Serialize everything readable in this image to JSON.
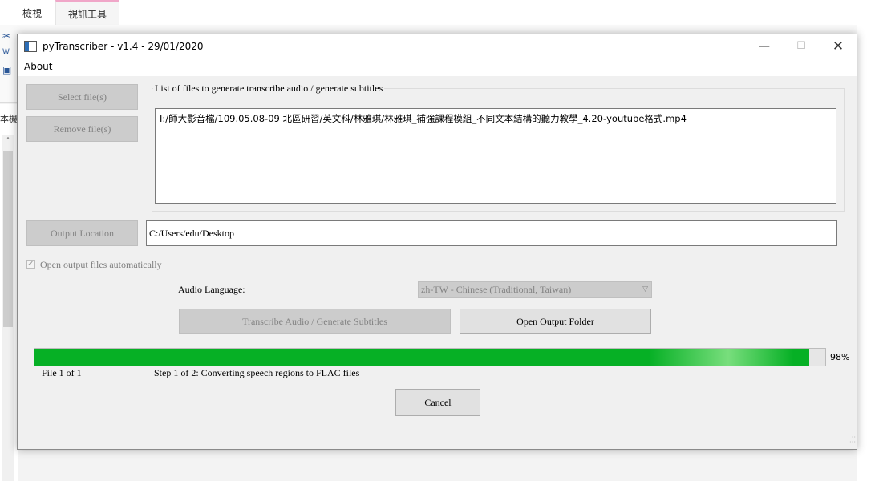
{
  "background": {
    "tabs": [
      "檢視",
      "視訊工具"
    ],
    "sidebar_label": "本機"
  },
  "window": {
    "title": "pyTranscriber - v1.4 - 29/01/2020",
    "menu": [
      "About"
    ]
  },
  "buttons": {
    "select_files": "Select file(s)",
    "remove_files": "Remove file(s)",
    "output_location": "Output Location",
    "transcribe": "Transcribe Audio / Generate Subtitles",
    "open_output_folder": "Open Output Folder",
    "cancel": "Cancel"
  },
  "file_list": {
    "label": "List of files to generate transcribe audio / generate subtitles",
    "items": [
      "I:/師大影音檔/109.05.08-09 北區研習/英文科/林雅琪/林雅琪_補強課程模組_不同文本結構的聽力教學_4.20-youtube格式.mp4"
    ]
  },
  "output": {
    "path": "C:/Users/edu/Desktop"
  },
  "options": {
    "open_automatically_label": "Open output files automatically",
    "open_automatically_checked": true
  },
  "language": {
    "label": "Audio Language:",
    "selected": "zh-TW - Chinese (Traditional, Taiwan)"
  },
  "progress": {
    "percent": 98,
    "percent_text": "98%",
    "file_counter": "File 1 of 1",
    "step": "Step 1 of 2: Converting speech regions to FLAC files"
  },
  "colors": {
    "progress_fill": "#06b025"
  }
}
